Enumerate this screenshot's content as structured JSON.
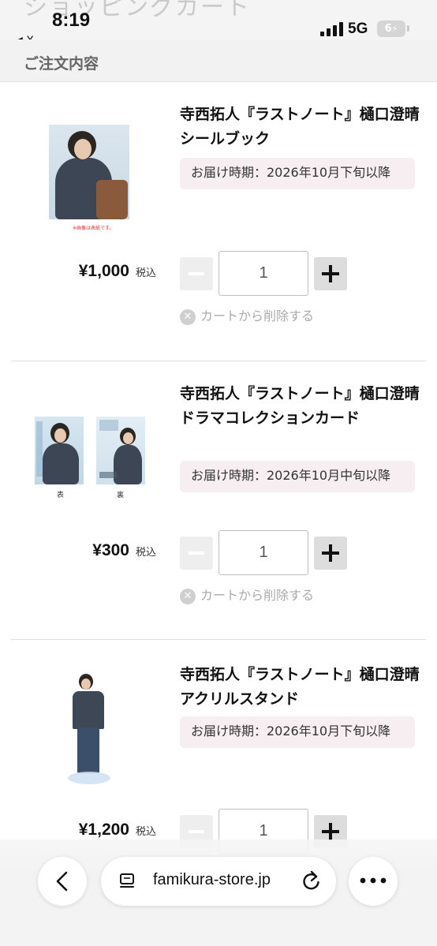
{
  "status_bar": {
    "ghost_title": "ショッピングカート",
    "time": "8:19",
    "back_app": "◀ X",
    "network": "5G",
    "battery": "6"
  },
  "section": {
    "title": "ご注文内容"
  },
  "items": [
    {
      "title": "寺西拓人『ラストノート』樋口澄晴 シールブック",
      "delivery": "お届け時期：2026年10月下旬以降",
      "price": "¥1,000",
      "tax": "税込",
      "quantity": "1",
      "remove": "カートから削除する",
      "image_note": "※画像は表紙です。"
    },
    {
      "title": "寺西拓人『ラストノート』樋口澄晴 ドラマコレクションカード",
      "delivery": "お届け時期：2026年10月中旬以降",
      "price": "¥300",
      "tax": "税込",
      "quantity": "1",
      "remove": "カートから削除する",
      "front_label": "表",
      "back_label": "裏"
    },
    {
      "title": "寺西拓人『ラストノート』樋口澄晴 アクリルスタンド",
      "delivery": "お届け時期：2026年10月下旬以降",
      "price": "¥1,200",
      "tax": "税込",
      "quantity": "1"
    }
  ],
  "browser": {
    "url": "famikura-store.jp",
    "icons": [
      "chevron-left-icon",
      "tabs-icon",
      "reload-icon",
      "more-icon"
    ]
  },
  "colors": {
    "delivery_bg": "#f6eef0",
    "header_bg": "#f2f2f2",
    "remove_text": "#aaaaaa"
  }
}
